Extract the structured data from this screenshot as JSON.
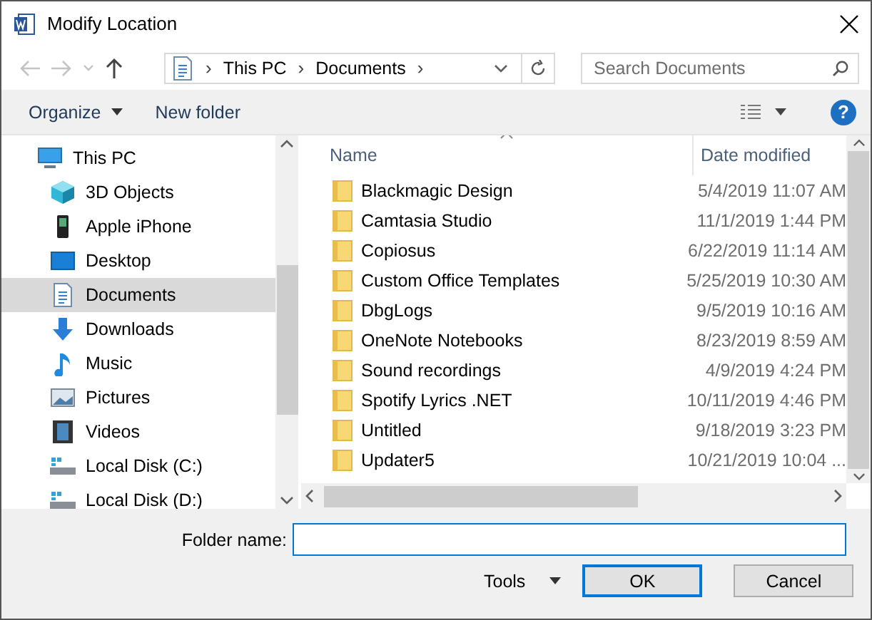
{
  "window": {
    "title": "Modify Location"
  },
  "address": {
    "crumbs": [
      "This PC",
      "Documents"
    ],
    "separator": "›"
  },
  "search": {
    "placeholder": "Search Documents"
  },
  "toolbar": {
    "organize": "Organize",
    "new_folder": "New folder",
    "help": "?"
  },
  "sidebar": {
    "items": [
      {
        "label": "This PC",
        "kind": "pc",
        "selected": false,
        "children": [
          {
            "label": "3D Objects",
            "kind": "cube",
            "selected": false
          },
          {
            "label": "Apple iPhone",
            "kind": "phone",
            "selected": false
          },
          {
            "label": "Desktop",
            "kind": "desktop",
            "selected": false
          },
          {
            "label": "Documents",
            "kind": "documents",
            "selected": true
          },
          {
            "label": "Downloads",
            "kind": "downloads",
            "selected": false
          },
          {
            "label": "Music",
            "kind": "music",
            "selected": false
          },
          {
            "label": "Pictures",
            "kind": "pictures",
            "selected": false
          },
          {
            "label": "Videos",
            "kind": "videos",
            "selected": false
          },
          {
            "label": "Local Disk (C:)",
            "kind": "disk",
            "selected": false
          },
          {
            "label": "Local Disk (D:)",
            "kind": "disk",
            "selected": false
          }
        ]
      }
    ]
  },
  "table": {
    "columns": [
      "Name",
      "Date modified"
    ],
    "rows": [
      {
        "name": "Blackmagic Design",
        "date": "5/4/2019 11:07 AM"
      },
      {
        "name": "Camtasia Studio",
        "date": "11/1/2019 1:44 PM"
      },
      {
        "name": "Copiosus",
        "date": "6/22/2019 11:14 AM"
      },
      {
        "name": "Custom Office Templates",
        "date": "5/25/2019 10:30 AM"
      },
      {
        "name": "DbgLogs",
        "date": "9/5/2019 10:16 AM"
      },
      {
        "name": "OneNote Notebooks",
        "date": "8/23/2019 8:59 AM"
      },
      {
        "name": "Sound recordings",
        "date": "4/9/2019 4:24 PM"
      },
      {
        "name": "Spotify Lyrics .NET",
        "date": "10/11/2019 4:46 PM"
      },
      {
        "name": "Untitled",
        "date": "9/18/2019 3:23 PM"
      },
      {
        "name": "Updater5",
        "date": "10/21/2019 10:04 ..."
      }
    ]
  },
  "footer": {
    "folder_label": "Folder name:",
    "tools": "Tools",
    "ok": "OK",
    "cancel": "Cancel"
  }
}
